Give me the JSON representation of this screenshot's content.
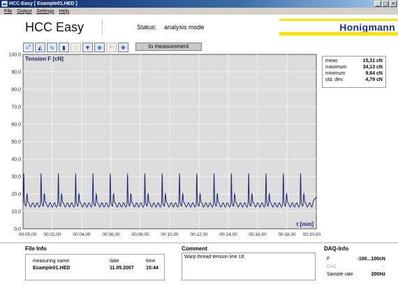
{
  "window": {
    "title": "HCC-Easy [ Example01.HED ]",
    "min_glyph": "_",
    "max_glyph": "□",
    "close_glyph": "×"
  },
  "menu": [
    "File",
    "Output",
    "Settings",
    "Help"
  ],
  "header": {
    "app_name": "HCC Easy",
    "status_label": "Status:",
    "status_value": "analysis mode",
    "brand": "Honigmann"
  },
  "toolbar": {
    "icons": [
      {
        "name": "zoom-fit-icon",
        "glyph": "⤢",
        "enabled": true
      },
      {
        "name": "chart-area-icon",
        "glyph": "◭",
        "enabled": true
      },
      {
        "name": "chart-line-icon",
        "glyph": "∿",
        "enabled": true
      },
      {
        "name": "chart-bars-icon",
        "glyph": "▮",
        "enabled": true
      },
      {
        "name": "cursor-icon",
        "glyph": "|",
        "enabled": false
      },
      {
        "name": "filter-icon",
        "glyph": "▼",
        "enabled": true
      },
      {
        "name": "zoom-in-icon",
        "glyph": "⊕",
        "enabled": true
      },
      {
        "name": "undo-zoom-icon",
        "glyph": "↶",
        "enabled": false
      },
      {
        "name": "pan-icon",
        "glyph": "✥",
        "enabled": true
      }
    ],
    "measure_button": "to measurement"
  },
  "chart_data": {
    "type": "line",
    "title": "Tension F [cN]",
    "xlabel": "t [min]",
    "ylabel": "",
    "xlim": [
      0,
      20
    ],
    "ylim": [
      0,
      100
    ],
    "grid": true,
    "y_ticks": [
      "0,0",
      "10,0",
      "20,0",
      "30,0",
      "40,0",
      "50,0",
      "60,0",
      "70,0",
      "80,0",
      "90,0",
      "100,0"
    ],
    "x_ticks": [
      "00:00,00",
      "00:02,00",
      "00:04,00",
      "00:06,00",
      "00:08,00",
      "00:10,00",
      "00:12,00",
      "00:14,00",
      "00:16,00",
      "00:18,00",
      "00:20,00"
    ],
    "series": [
      {
        "color": "#1a2a70",
        "pattern": {
          "peak_times_min": [
            0.05,
            1.23,
            2.41,
            3.59,
            4.77,
            5.95,
            7.13,
            8.31,
            9.49,
            10.67,
            11.85,
            13.03,
            14.21,
            15.39,
            16.57,
            17.75,
            18.93
          ],
          "peak_height": 33.5,
          "secondary_peak_height": 23.5,
          "baseline_low": 12.5,
          "baseline_high": 16.5,
          "end_value": 18.5
        }
      }
    ],
    "color_plot_bg": "#dcdcdc"
  },
  "stats": [
    {
      "label": "mean",
      "value": "15,31 cN"
    },
    {
      "label": "maximum",
      "value": "34,13 cN"
    },
    {
      "label": "minimum",
      "value": "9,64 cN"
    },
    {
      "label": "std. dev.",
      "value": "4,79 cN"
    }
  ],
  "file_info": {
    "title": "File Info",
    "headers": [
      "measuring name",
      "date",
      "time"
    ],
    "values": [
      "Example01.HED",
      "11.05.2007",
      "15:44"
    ]
  },
  "comment": {
    "title": "Comment",
    "text": "Warp thread tension line 18"
  },
  "daq": {
    "title": "DAQ-Info",
    "rows": [
      {
        "label": "F",
        "value": "-100...100cN",
        "muted": false
      },
      {
        "label": "CH1",
        "value": "---",
        "muted": true
      },
      {
        "label": "Sample rate",
        "value": "200Hz",
        "muted": false
      }
    ]
  }
}
